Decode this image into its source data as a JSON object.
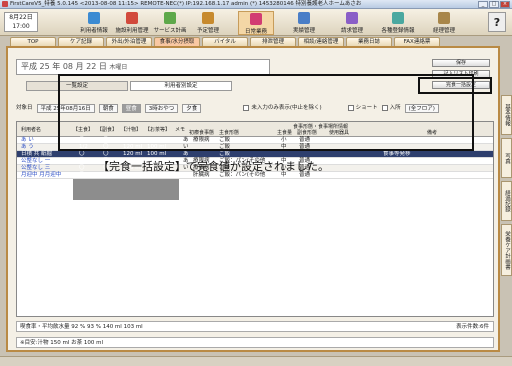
{
  "window": {
    "title": "FirstCareV5_特養 5.0.145 <2013-08-08 11:15> REMOTE-NEC(*) IP:192.168.1.17 admin (*) 1453280146 特別養護老人ホームあさお"
  },
  "toolbar": {
    "date": "8月22日",
    "time": "17:00",
    "items": [
      {
        "label": "利用者情報",
        "color": "#3c8bd2"
      },
      {
        "label": "施設利用管理",
        "color": "#d24a3c"
      },
      {
        "label": "サービス計画",
        "color": "#5ea84a"
      },
      {
        "label": "予定管理",
        "color": "#c78a2e"
      },
      {
        "label": "日常業務",
        "color": "#d23c72"
      },
      {
        "label": "実績管理",
        "color": "#4a7ec7"
      },
      {
        "label": "請求管理",
        "color": "#8a5ec7"
      },
      {
        "label": "各種登録情報",
        "color": "#4aa8a0"
      },
      {
        "label": "経理管理",
        "color": "#a8864a"
      }
    ],
    "help_label": "?"
  },
  "tabs": [
    "TOP",
    "ケア記録",
    "外出/外泊管理",
    "食事/水分摂取",
    "バイタル",
    "排泄管理",
    "相談/連絡管理",
    "業務日誌",
    "FAX連絡票"
  ],
  "side_tabs": [
    "基本情報",
    "写真",
    "経過記録",
    "栄養ケア計画書"
  ],
  "panel": {
    "date_era": "平成",
    "date_year": "25",
    "date_y_label": "年",
    "date_month": "08",
    "date_m_label": "月",
    "date_day": "22",
    "date_d_label": "日",
    "date_weekday": "木曜日",
    "subtabs": [
      "一覧設定",
      "利用者別設定"
    ],
    "buttons": {
      "save": "保存",
      "list_print": "記入リスト印刷",
      "bulk": "完食一括設定"
    }
  },
  "filters": {
    "target_date_label": "対象日",
    "target_date_value": "平成 25年08月16日",
    "meals": [
      "朝食",
      "昼食",
      "3時おやつ",
      "夕食"
    ],
    "selected_meal": "昼食",
    "unentered_label": "未入力のみ表示(中止を除く)",
    "short_label": "ショート",
    "nyusho_label": "入所",
    "floor_value": "(全フロア)"
  },
  "grid": {
    "headers": [
      "利用者名",
      "【主食】",
      "【副食】",
      "【汁物】",
      "【お茶等】",
      "メモ",
      "朝食",
      "食事・食事場所",
      "主食形態",
      "主食量",
      "副食形態",
      "使用器具",
      "備考"
    ],
    "extra_headers": [
      "初療食事態",
      "主食量",
      "食事形態・食事場所情報",
      "副食形態"
    ],
    "rows": [
      {
        "name": "あ い",
        "staple": "〇",
        "side": "〇",
        "soup": "120 ml",
        "tea": "100 ml",
        "flag": "あ",
        "diet": "療限病",
        "shape": "ご飯",
        "amount": "小",
        "sidetype": "普通",
        "note": ""
      },
      {
        "name": "あ う",
        "staple": "1/2",
        "side": "〇",
        "soup": "120 ml",
        "tea": "100 ml",
        "flag": "い",
        "diet": "",
        "shape": "ご飯",
        "amount": "中",
        "sidetype": "普通",
        "note": ""
      },
      {
        "name": "日積 共 紙掘",
        "staple": "〇",
        "side": "〇",
        "soup": "120 ml",
        "tea": "100 ml",
        "flag": "あ",
        "diet": "",
        "shape": "ご飯",
        "amount": "",
        "sidetype": "",
        "note": "食事等発移"
      },
      {
        "name": "公整なし 一",
        "staple": "〇",
        "side": "〇",
        "soup": "120 ml",
        "tea": "100 ml",
        "flag": "あ",
        "diet": "療限病",
        "shape": "ご飯：パン(その他",
        "amount": "中",
        "sidetype": "普通",
        "note": ""
      },
      {
        "name": "公整なし 三",
        "staple": "〇",
        "side": "〇",
        "soup": "120 ml",
        "tea": "100 ml",
        "flag": "い",
        "diet": "療限病",
        "shape": "ご飯",
        "amount": "小",
        "sidetype": "普通",
        "note": ""
      },
      {
        "name": "月迎中 月月迎中",
        "staple": "〇",
        "side": "〇",
        "soup": "120 ml",
        "tea": "100 ml",
        "flag": "",
        "diet": "肝臓病",
        "shape": "ご飯：パン(その他",
        "amount": "中",
        "sidetype": "普通",
        "note": ""
      }
    ]
  },
  "annotation": "【完食一括設定】で完食値が設定されました。",
  "footer": {
    "summary": "喫食率・平均飲水量 92 % 93 % 140 ml 103 ml",
    "target": "※目安:汁物 150 ml お茶 100 ml",
    "count": "表示件数:6件"
  }
}
